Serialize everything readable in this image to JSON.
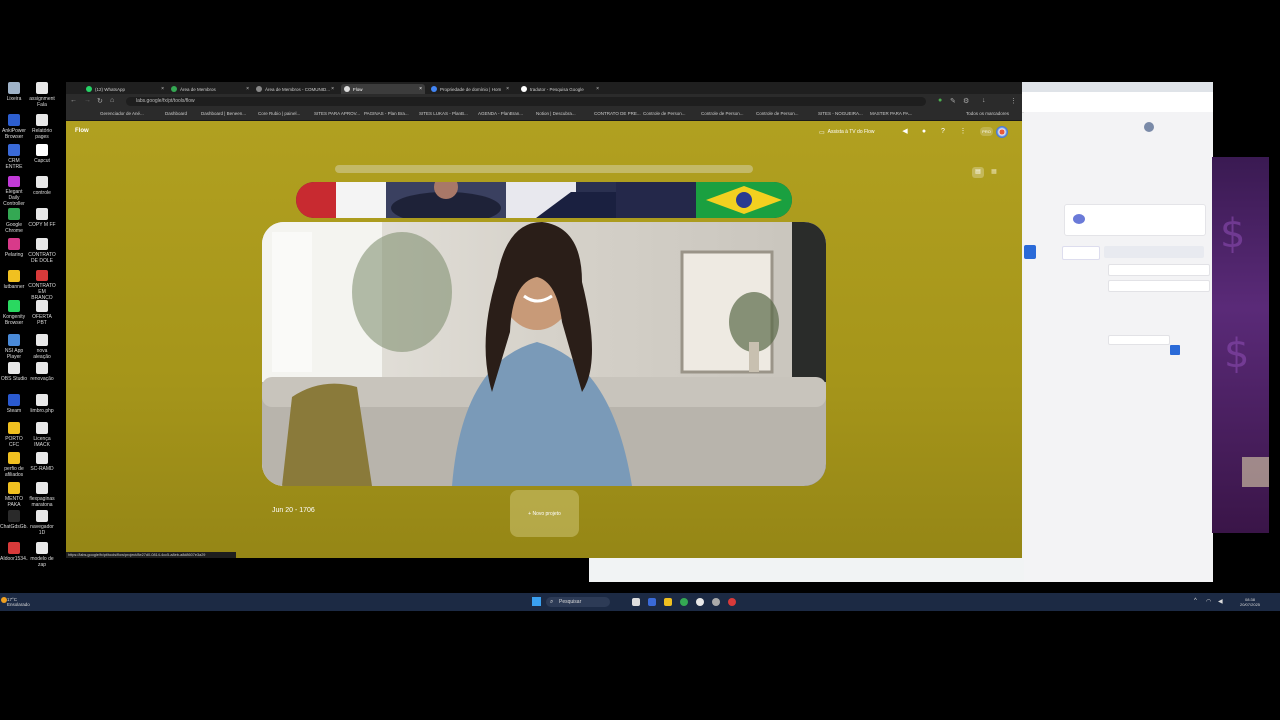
{
  "desktop": {
    "icons": [
      {
        "label": "Lixeira",
        "color": "#9fb3c8"
      },
      {
        "label": "assignment Fala",
        "color": "#e8e8e8"
      },
      {
        "label": "AnkiPower Browser",
        "color": "#2d5fd0"
      },
      {
        "label": "Relatório pages",
        "color": "#e8e8e8"
      },
      {
        "label": "CRM ENTRE",
        "color": "#3a6ad8"
      },
      {
        "label": "Capcut",
        "color": "#ffffff"
      },
      {
        "label": "Elegant Daily Controller",
        "color": "#c23ad8"
      },
      {
        "label": "controle",
        "color": "#e8e8e8"
      },
      {
        "label": "Google Chrome",
        "color": "#34a853"
      },
      {
        "label": "COPY M FF",
        "color": "#e8e8e8"
      },
      {
        "label": "Pelaring",
        "color": "#d83a8a"
      },
      {
        "label": "CONTRATO DE DOLE",
        "color": "#e8e8e8"
      },
      {
        "label": "lutbanner",
        "color": "#f0c020"
      },
      {
        "label": "CONTRATO EM BRANCO",
        "color": "#d83a3a"
      },
      {
        "label": "Kongenity Browser",
        "color": "#2ad860"
      },
      {
        "label": "OFERTA PBT",
        "color": "#e8e8e8"
      },
      {
        "label": "NSI App Player",
        "color": "#4a8ad8"
      },
      {
        "label": "nova aleação",
        "color": "#e8e8e8"
      },
      {
        "label": "OBS Studio",
        "color": "#e8e8e8"
      },
      {
        "label": "renovação",
        "color": "#e8e8e8"
      },
      {
        "label": "Steam",
        "color": "#2a5ad0"
      },
      {
        "label": "limbro.php",
        "color": "#e8e8e8"
      },
      {
        "label": "PORTO CFC",
        "color": "#f0c020"
      },
      {
        "label": "Licença IMACK",
        "color": "#e8e8e8"
      },
      {
        "label": "perfio de afiliados",
        "color": "#f0c020"
      },
      {
        "label": "SC-RAMD",
        "color": "#e8e8e8"
      },
      {
        "label": "MENTO PAKA",
        "color": "#f0c020"
      },
      {
        "label": "flexpaginas maratona",
        "color": "#e8e8e8"
      },
      {
        "label": "ChatGdsGb...",
        "color": "#2a2a2a"
      },
      {
        "label": "navegador 1D",
        "color": "#e8e8e8"
      },
      {
        "label": "AIdoor1534...",
        "color": "#d83a3a"
      },
      {
        "label": "modelo de zap",
        "color": "#e8e8e8"
      }
    ]
  },
  "browser": {
    "tabs": [
      {
        "label": "(12) WhatsApp",
        "color": "#25d366"
      },
      {
        "label": "Área de Membros",
        "color": "#34a853"
      },
      {
        "label": "Área de Membros - COMUNID...",
        "color": "#888888"
      },
      {
        "label": "Flow",
        "color": "#dddddd"
      },
      {
        "label": "Propriedade de domínio | Hom",
        "color": "#4285f4"
      },
      {
        "label": "tradutor - Pesquisa Google",
        "color": "#ffffff"
      }
    ],
    "url": "labs.google/fx/pt/tools/flow",
    "bookmarks": [
      "Gerenciador de Ané...",
      "Dashboard",
      "Dashboard | Beneen...",
      "Core Rubio | painel...",
      "SITES PARA APROV...",
      "PAGINAS - Plan Bra...",
      "SITES LUKAS - PlanB...",
      "AGENDA - PlanBran...",
      "Notion | Descubra...",
      "CONTRATO DE PRE...",
      "Controle de Person...",
      "Controle de Person...",
      "Controle de Person...",
      "SITES - NOGUEIRA...",
      "MASTER PARA PA...",
      "Todos os marcadores"
    ],
    "status_url": "https://labs.google/fx/pt/tools/flow/project/8e27d0-0814-4cc5-a8eb-a8d8607e3a29"
  },
  "flow": {
    "title": "Flow",
    "assist_label": "Assista à TV do Flow",
    "pro_badge": "PRO",
    "project_date": "Jun 20 - 1706",
    "new_project_label": "+ Novo projeto",
    "accent_color": "#a99a1c"
  },
  "taskbar": {
    "weather_temp": "17°C",
    "weather_desc": "Ensolarado",
    "search_placeholder": "Pesquisar",
    "time": "08:38",
    "date": "20/07/2025"
  }
}
